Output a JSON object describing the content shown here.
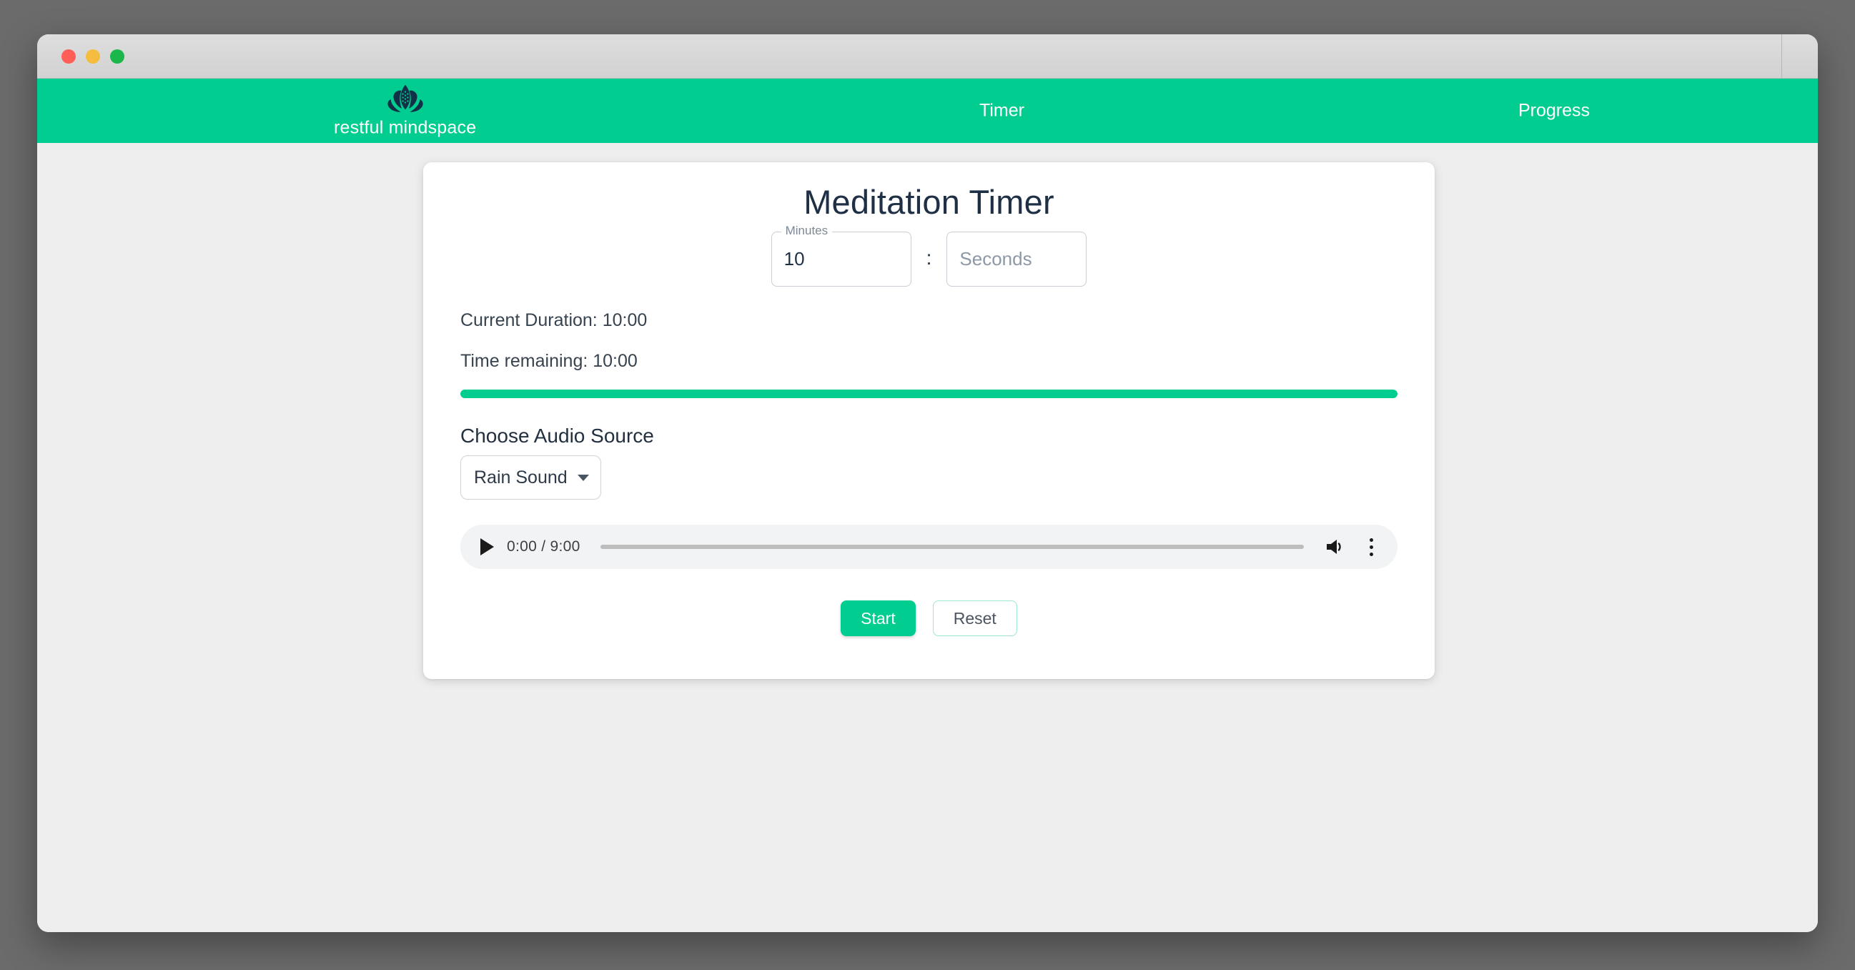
{
  "window": {
    "traffic_lights": [
      {
        "name": "close",
        "color": "#ff5f57"
      },
      {
        "name": "minimize",
        "color": "#f5bd40"
      },
      {
        "name": "maximize",
        "color": "#1cb74b"
      }
    ]
  },
  "header": {
    "background_color": "#00cd8f",
    "brand_name": "restful mindspace",
    "logo_icon": "lotus-icon",
    "logo_color": "#123047",
    "nav": [
      {
        "id": "timer",
        "label": "Timer"
      },
      {
        "id": "progress",
        "label": "Progress"
      }
    ]
  },
  "card": {
    "title": "Meditation Timer",
    "minutes_field": {
      "legend": "Minutes",
      "value": "10",
      "placeholder": "Minutes"
    },
    "separator": ":",
    "seconds_field": {
      "legend": "Seconds",
      "value": "",
      "placeholder": "Seconds"
    },
    "current_duration": "Current Duration: 10:00",
    "time_remaining": "Time remaining: 10:00",
    "progress": {
      "percent": 100,
      "fill_color": "#00cd8f"
    },
    "audio_section": {
      "heading": "Choose Audio Source",
      "selected": "Rain Sound",
      "caret_icon": "chevron-down-icon"
    },
    "audio_player": {
      "play_icon": "play-icon",
      "time_display": "0:00 / 9:00",
      "current_time": "0:00",
      "duration": "9:00",
      "seek_percent": 0,
      "volume_icon": "volume-icon",
      "menu_icon": "more-vertical-icon"
    },
    "buttons": {
      "start": "Start",
      "reset": "Reset"
    }
  }
}
